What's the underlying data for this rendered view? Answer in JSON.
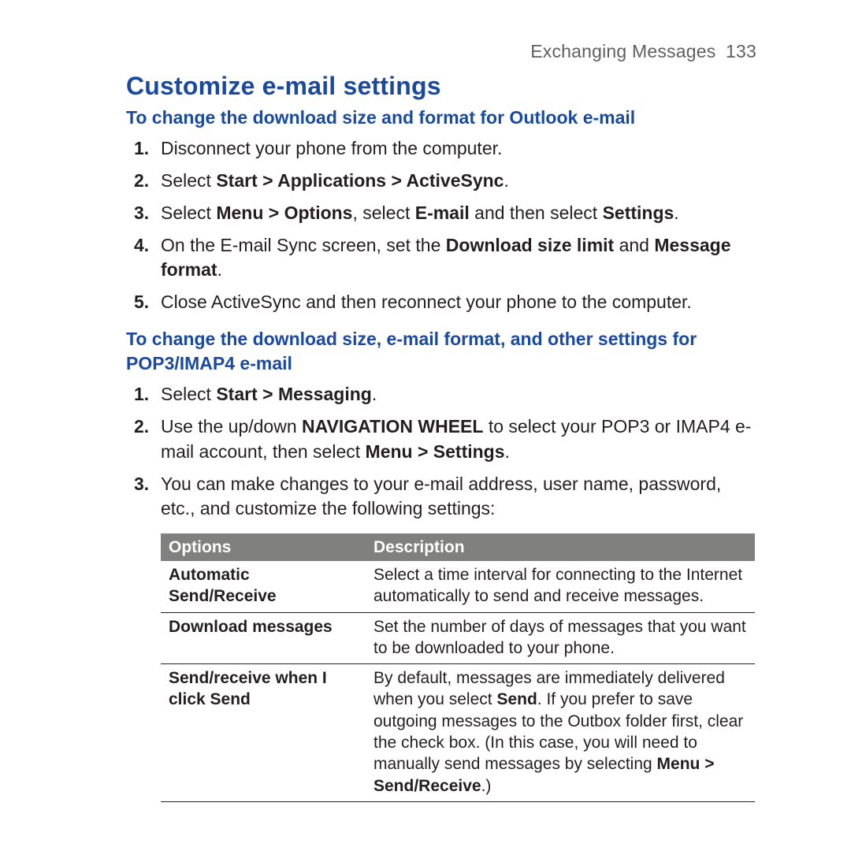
{
  "header": {
    "chapter": "Exchanging Messages",
    "page_number": "133"
  },
  "title": "Customize e-mail settings",
  "sections": [
    {
      "heading": "To change the download size and format for Outlook e-mail",
      "steps": [
        {
          "n": "1.",
          "plain_before": "Disconnect your phone from the computer."
        },
        {
          "n": "2.",
          "plain_before": "Select ",
          "bold": "Start > Applications > ActiveSync",
          "plain_after": "."
        },
        {
          "n": "3.",
          "html_key": "step_outlook_3"
        },
        {
          "n": "4.",
          "html_key": "step_outlook_4"
        },
        {
          "n": "5.",
          "plain_before": "Close ActiveSync and then reconnect your phone to the computer."
        }
      ]
    },
    {
      "heading": "To change the download size, e-mail format, and other settings for POP3/IMAP4 e-mail",
      "steps": [
        {
          "n": "1.",
          "plain_before": "Select ",
          "bold": "Start > Messaging",
          "plain_after": "."
        },
        {
          "n": "2.",
          "html_key": "step_pop_2"
        },
        {
          "n": "3.",
          "plain_before": "You can make changes to your e-mail address, user name, password, etc., and customize the following settings:"
        }
      ]
    }
  ],
  "rich": {
    "step_outlook_3": "Select <span class=\"b\">Menu > Options</span>, select <span class=\"b\">E-mail</span> and then select <span class=\"b\">Settings</span>.",
    "step_outlook_4": "On the E-mail Sync screen, set the <span class=\"b\">Download size limit</span> and <span class=\"b\">Message format</span>.",
    "step_pop_2": "Use the up/down <span class=\"b\">NAVIGATION WHEEL</span> to select your POP3 or IMAP4 e-mail account, then select <span class=\"b\">Menu > Settings</span>."
  },
  "table": {
    "headers": {
      "options": "Options",
      "description": "Description"
    },
    "rows": [
      {
        "option": "Automatic Send/Receive",
        "desc_html_key": "row1"
      },
      {
        "option": "Download messages",
        "desc_html_key": "row2"
      },
      {
        "option": "Send/receive when I click Send",
        "desc_html_key": "row3"
      }
    ]
  },
  "table_rich": {
    "row1": "Select a time interval for connecting to the Internet automatically to send and receive messages.",
    "row2": "Set the number of days of messages that you want to be downloaded to your phone.",
    "row3": "By default, messages are immediately delivered when you select <span class=\"b\">Send</span>. If you prefer to save outgoing messages to the Outbox folder first, clear the check box. (In this case, you will need to manually send messages by selecting <span class=\"b\">Menu > Send/Receive</span>.)"
  }
}
